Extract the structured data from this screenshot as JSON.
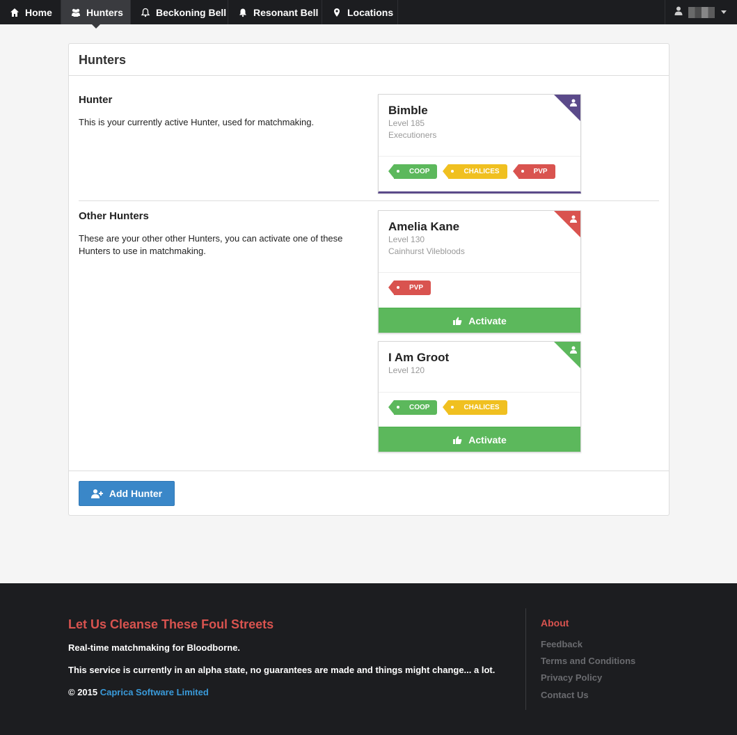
{
  "nav": {
    "items": [
      {
        "label": "Home",
        "icon": "home-icon"
      },
      {
        "label": "Hunters",
        "icon": "users-icon",
        "active": true
      },
      {
        "label": "Beckoning Bell",
        "icon": "bell-outline-icon"
      },
      {
        "label": "Resonant Bell",
        "icon": "bell-icon"
      },
      {
        "label": "Locations",
        "icon": "map-marker-icon"
      }
    ],
    "user_icon": "user-icon"
  },
  "panel": {
    "title": "Hunters",
    "active_section": {
      "title": "Hunter",
      "text": "This is your currently active Hunter, used for matchmaking."
    },
    "other_section": {
      "title": "Other Hunters",
      "text": "These are your other other Hunters, you can activate one of these Hunters to use in matchmaking."
    },
    "add_button": "Add Hunter"
  },
  "hunters": [
    {
      "name": "Bimble",
      "level": "Level 185",
      "clan": "Executioners",
      "corner_color": "#5b4a8a",
      "tags": [
        "COOP",
        "CHALICES",
        "PVP"
      ]
    },
    {
      "name": "Amelia Kane",
      "level": "Level 130",
      "clan": "Cainhurst Vilebloods",
      "corner_color": "#d9534f",
      "tags": [
        "PVP"
      ],
      "action": "Activate"
    },
    {
      "name": "I Am Groot",
      "level": "Level 120",
      "clan": "",
      "corner_color": "#5cb85c",
      "tags": [
        "COOP",
        "CHALICES"
      ],
      "action": "Activate"
    }
  ],
  "footer": {
    "tagline": "Let Us Cleanse These Foul Streets",
    "line1": "Real-time matchmaking for Bloodborne.",
    "line2": "This service is currently in an alpha state, no guarantees are made and things might change... a lot.",
    "copyright": "© 2015",
    "company": "Caprica Software Limited",
    "about_title": "About",
    "links": [
      "Feedback",
      "Terms and Conditions",
      "Privacy Policy",
      "Contact Us"
    ]
  },
  "colors": {
    "coop": "#5cb85c",
    "chalices": "#f0c020",
    "pvp": "#d9534f",
    "primary": "#3a87c8",
    "accent_red": "#d9534f"
  }
}
